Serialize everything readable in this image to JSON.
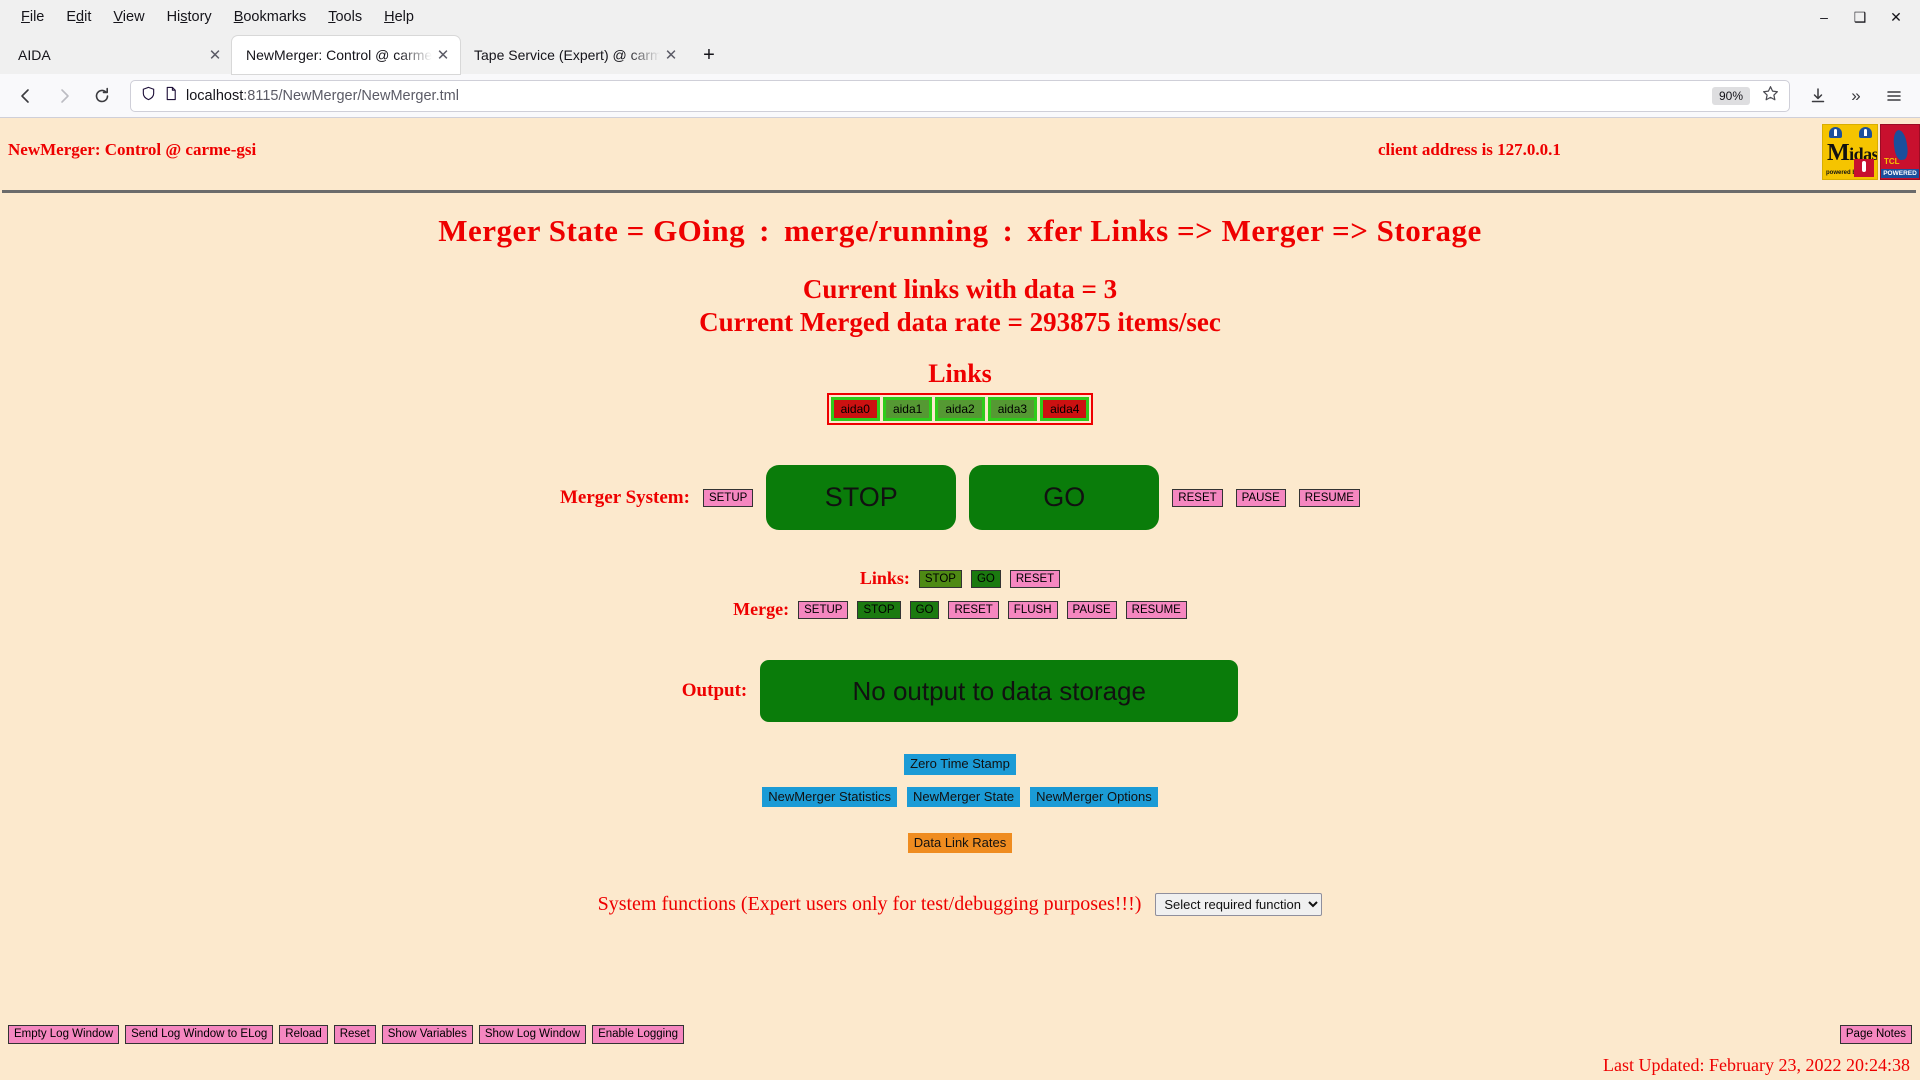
{
  "browser": {
    "menus": [
      {
        "label": "File",
        "accel": "F"
      },
      {
        "label": "Edit",
        "accel": "E"
      },
      {
        "label": "View",
        "accel": "V"
      },
      {
        "label": "History",
        "accel": "s"
      },
      {
        "label": "Bookmarks",
        "accel": "B"
      },
      {
        "label": "Tools",
        "accel": "T"
      },
      {
        "label": "Help",
        "accel": "H"
      }
    ],
    "window_controls": {
      "minimize": "–",
      "maximize": "❑",
      "close": "✕"
    },
    "tabs": [
      {
        "title": "AIDA",
        "active": false,
        "close": "✕"
      },
      {
        "title": "NewMerger: Control @ carme-gsi",
        "active": true,
        "close": "✕"
      },
      {
        "title": "Tape Service (Expert) @ carme-gsi",
        "active": false,
        "close": "✕"
      }
    ],
    "new_tab_label": "+",
    "nav": {
      "back": "←",
      "forward": "→",
      "reload": "↻"
    },
    "url": {
      "host": "localhost",
      "path": ":8115/NewMerger/NewMerger.tml",
      "shield_icon": "shield-icon",
      "page-icon": "page-icon"
    },
    "zoom_level": "90%",
    "bookmark_star": "☆",
    "toolbar_right": {
      "download": "⤓",
      "overflow": "»",
      "menu": "☰"
    }
  },
  "page": {
    "header": {
      "title": "NewMerger: Control @ carme-gsi",
      "client_address": "client address is 127.0.0.1",
      "logo_midas": {
        "name": "midas-logo",
        "text_m": "M",
        "text_idas": "idas",
        "powered_by": "powered by"
      },
      "logo_tcl": {
        "name": "tcl-powered-logo",
        "tcl": "TCL",
        "powered": "POWERED"
      }
    },
    "state_line": {
      "merger_state": "Merger State = GOing",
      "sep1": ":",
      "merge_status": "merge/running",
      "sep2": ":",
      "xfer": "xfer Links => Merger => Storage"
    },
    "rates": {
      "links_with_data": "Current links with data = 3",
      "merged_rate": "Current Merged data rate = 293875 items/sec"
    },
    "links_section": {
      "title": "Links",
      "links": [
        {
          "label": "aida0",
          "state": "bad"
        },
        {
          "label": "aida1",
          "state": "ok"
        },
        {
          "label": "aida2",
          "state": "ok"
        },
        {
          "label": "aida3",
          "state": "ok"
        },
        {
          "label": "aida4",
          "state": "bad"
        }
      ]
    },
    "merger_system": {
      "label": "Merger System:",
      "setup": "SETUP",
      "stop": "STOP",
      "go": "GO",
      "reset": "RESET",
      "pause": "PAUSE",
      "resume": "RESUME"
    },
    "links_control": {
      "label": "Links:",
      "stop": "STOP",
      "go": "GO",
      "reset": "RESET"
    },
    "merge_control": {
      "label": "Merge:",
      "setup": "SETUP",
      "stop": "STOP",
      "go": "GO",
      "reset": "RESET",
      "flush": "FLUSH",
      "pause": "PAUSE",
      "resume": "RESUME"
    },
    "output": {
      "label": "Output:",
      "status": "No output to data storage"
    },
    "nav_buttons": {
      "zero_time_stamp": "Zero Time Stamp",
      "statistics": "NewMerger Statistics",
      "state": "NewMerger State",
      "options": "NewMerger Options",
      "data_link_rates": "Data Link Rates"
    },
    "system_functions": {
      "label": "System functions (Expert users only for test/debugging purposes!!!)",
      "select_value": "Select required function"
    },
    "bottom_bar": {
      "buttons": [
        "Empty Log Window",
        "Send Log Window to ELog",
        "Reload",
        "Reset",
        "Show Variables",
        "Show Log Window",
        "Enable Logging"
      ],
      "page_notes": "Page Notes"
    },
    "last_updated": "Last Updated: February 23, 2022 20:24:38"
  },
  "colors": {
    "page_bg": "#fce9cd",
    "red_text": "#ee0000",
    "green_button": "#0a7c0a",
    "pink_button": "#f587c0",
    "blue_button": "#1b9bd6",
    "orange_button": "#ef8c20",
    "link_ok": "#559933",
    "link_bad": "#cc1111",
    "link_border": "#2ecc1a"
  }
}
